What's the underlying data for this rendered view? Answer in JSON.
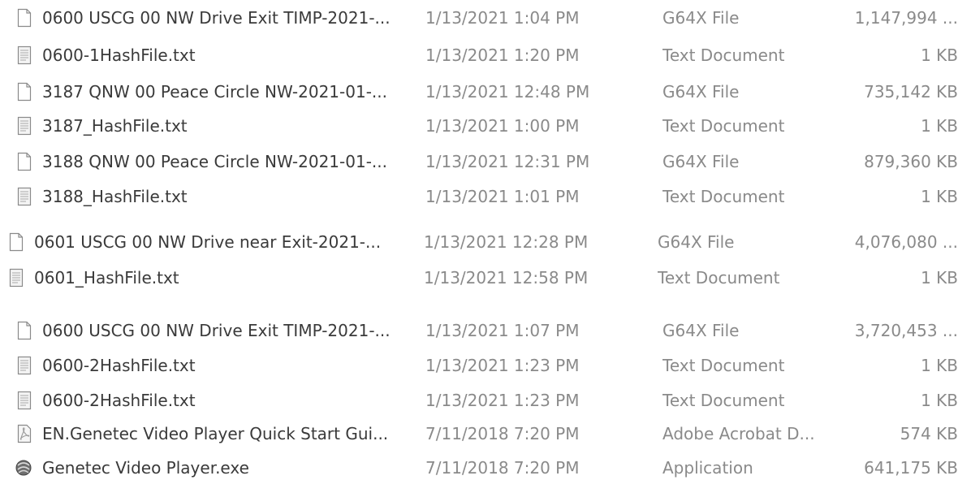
{
  "files": [
    {
      "name": "0600 USCG 00 NW Drive Exit TIMP-2021-...",
      "date": "1/13/2021 1:04 PM",
      "type": "G64X File",
      "size": "1,147,994 ...",
      "icon": "blank-file-icon"
    },
    {
      "name": "0600-1HashFile.txt",
      "date": "1/13/2021 1:20 PM",
      "type": "Text Document",
      "size": "1 KB",
      "icon": "text-file-icon"
    },
    {
      "name": "3187 QNW 00 Peace Circle NW-2021-01-...",
      "date": "1/13/2021 12:48 PM",
      "type": "G64X File",
      "size": "735,142 KB",
      "icon": "blank-file-icon"
    },
    {
      "name": "3187_HashFile.txt",
      "date": "1/13/2021 1:00 PM",
      "type": "Text Document",
      "size": "1 KB",
      "icon": "text-file-icon"
    },
    {
      "name": "3188 QNW 00 Peace Circle NW-2021-01-...",
      "date": "1/13/2021 12:31 PM",
      "type": "G64X File",
      "size": "879,360 KB",
      "icon": "blank-file-icon"
    },
    {
      "name": "3188_HashFile.txt",
      "date": "1/13/2021 1:01 PM",
      "type": "Text Document",
      "size": "1 KB",
      "icon": "text-file-icon"
    },
    {
      "name": "0601 USCG 00 NW Drive near Exit-2021-...",
      "date": "1/13/2021 12:28 PM",
      "type": "G64X File",
      "size": "4,076,080 ...",
      "icon": "blank-file-icon"
    },
    {
      "name": "0601_HashFile.txt",
      "date": "1/13/2021 12:58 PM",
      "type": "Text Document",
      "size": "1 KB",
      "icon": "text-file-icon"
    },
    {
      "name": "0600 USCG 00 NW Drive Exit TIMP-2021-...",
      "date": "1/13/2021 1:07 PM",
      "type": "G64X File",
      "size": "3,720,453 ...",
      "icon": "blank-file-icon"
    },
    {
      "name": "0600-2HashFile.txt",
      "date": "1/13/2021 1:23 PM",
      "type": "Text Document",
      "size": "1 KB",
      "icon": "text-file-icon"
    },
    {
      "name": "0600-2HashFile.txt",
      "date": "1/13/2021 1:23 PM",
      "type": "Text Document",
      "size": "1 KB",
      "icon": "text-file-icon"
    },
    {
      "name": "EN.Genetec Video Player Quick Start Gui...",
      "date": "7/11/2018 7:20 PM",
      "type": "Adobe Acrobat D...",
      "size": "574 KB",
      "icon": "pdf-file-icon"
    },
    {
      "name": "Genetec Video Player.exe",
      "date": "7/11/2018 7:20 PM",
      "type": "Application",
      "size": "641,175 KB",
      "icon": "application-icon"
    }
  ]
}
